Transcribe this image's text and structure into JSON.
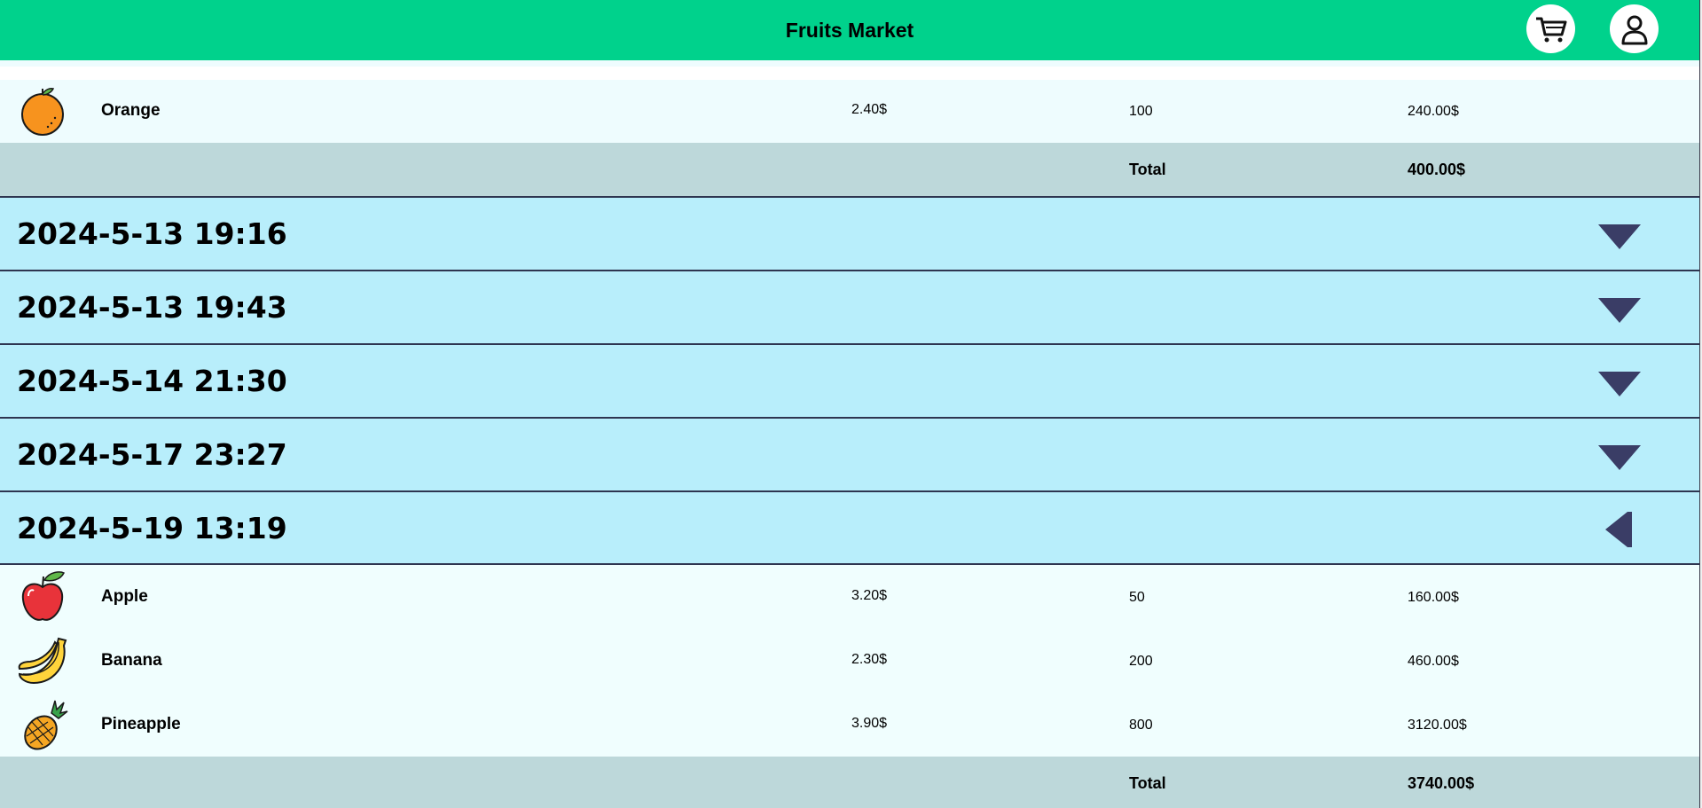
{
  "header": {
    "title": "Fruits Market",
    "cart_icon": "cart-icon",
    "user_icon": "user-icon"
  },
  "colors": {
    "header_bg": "#00d28c",
    "order_header_bg": "#b8eefb",
    "item_row_bg": "#eefcfe",
    "total_row_bg": "#bdd8da",
    "toggle_arrow": "#3a3d66"
  },
  "prev_order": {
    "partial_item_icon": "apple-icon",
    "items": [
      {
        "name": "Orange",
        "icon": "orange-icon",
        "price": "2.40$",
        "quantity": "100",
        "subtotal": "240.00$"
      }
    ],
    "total_label": "Total",
    "total_value": "400.00$"
  },
  "orders": [
    {
      "date": "2024-5-13 19:16",
      "expanded": false
    },
    {
      "date": "2024-5-13 19:43",
      "expanded": false
    },
    {
      "date": "2024-5-14 21:30",
      "expanded": false
    },
    {
      "date": "2024-5-17 23:27",
      "expanded": false
    },
    {
      "date": "2024-5-19 13:19",
      "expanded": true
    }
  ],
  "expanded_order": {
    "items": [
      {
        "name": "Apple",
        "icon": "apple-icon",
        "price": "3.20$",
        "quantity": "50",
        "subtotal": "160.00$"
      },
      {
        "name": "Banana",
        "icon": "banana-icon",
        "price": "2.30$",
        "quantity": "200",
        "subtotal": "460.00$"
      },
      {
        "name": "Pineapple",
        "icon": "pineapple-icon",
        "price": "3.90$",
        "quantity": "800",
        "subtotal": "3120.00$"
      }
    ],
    "total_label": "Total",
    "total_value": "3740.00$"
  }
}
